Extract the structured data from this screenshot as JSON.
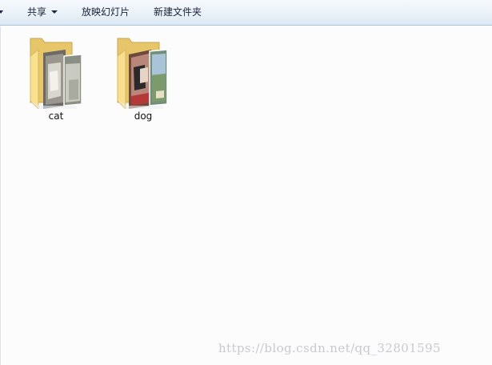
{
  "toolbar": {
    "share_label": "共享",
    "slideshow_label": "放映幻灯片",
    "new_folder_label": "新建文件夹"
  },
  "items": [
    {
      "name": "cat",
      "type": "folder"
    },
    {
      "name": "dog",
      "type": "folder"
    }
  ],
  "watermark": "https://blog.csdn.net/qq_32801595",
  "colors": {
    "folder_back": "#e7c66a",
    "folder_front": "#f8e08e",
    "toolbar_bg": "#e8f0f8",
    "toolbar_border": "#a9c0d9"
  }
}
